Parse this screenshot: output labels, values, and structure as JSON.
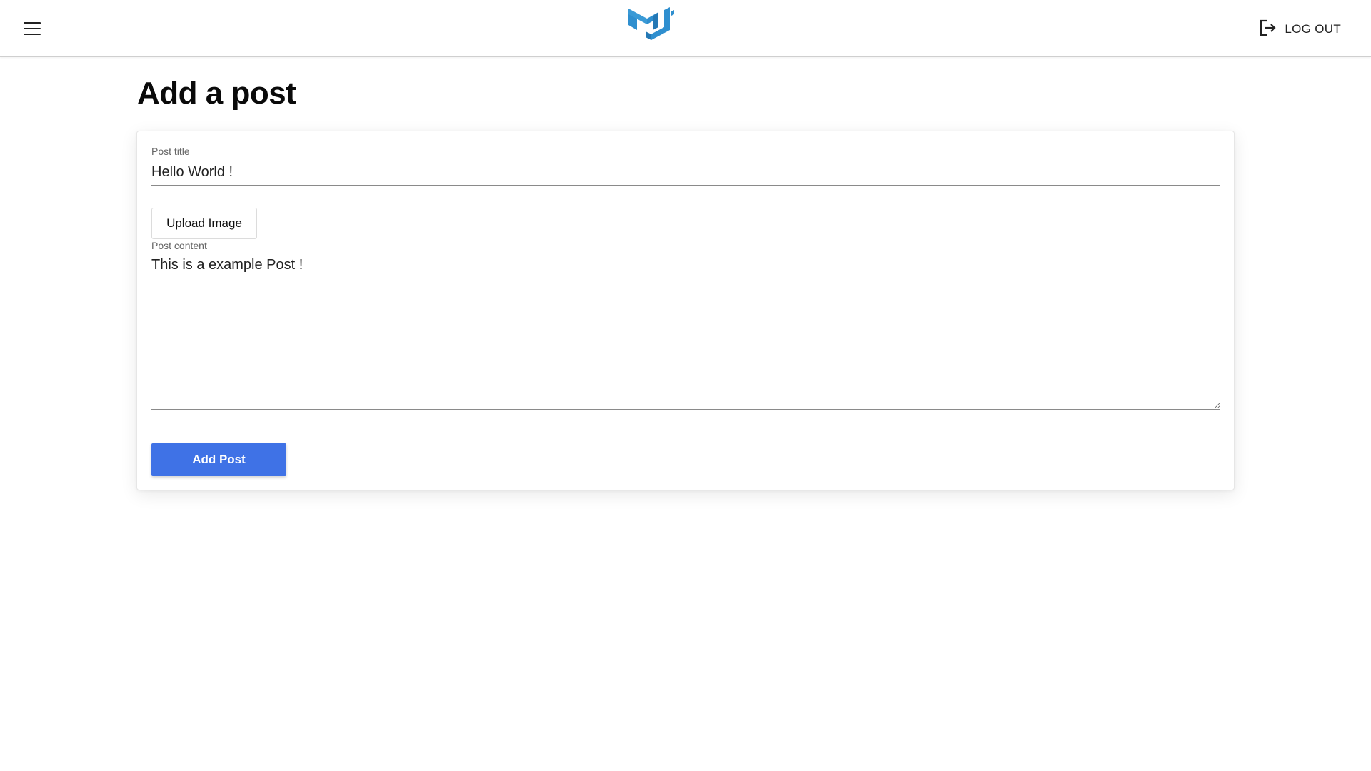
{
  "header": {
    "menu_icon": "hamburger-menu-icon",
    "logo_icon": "mui-logo-icon",
    "logo_color": "#2f8fcf",
    "logout": {
      "icon": "logout-icon",
      "label": "LOG OUT"
    }
  },
  "page": {
    "title": "Add a post"
  },
  "form": {
    "title_field": {
      "label": "Post title",
      "value": "Hello World !"
    },
    "upload_button": {
      "label": "Upload Image"
    },
    "content_field": {
      "label": "Post content",
      "value": "This is a example Post !"
    },
    "submit_button": {
      "label": "Add Post",
      "color": "#3f72e6"
    }
  }
}
